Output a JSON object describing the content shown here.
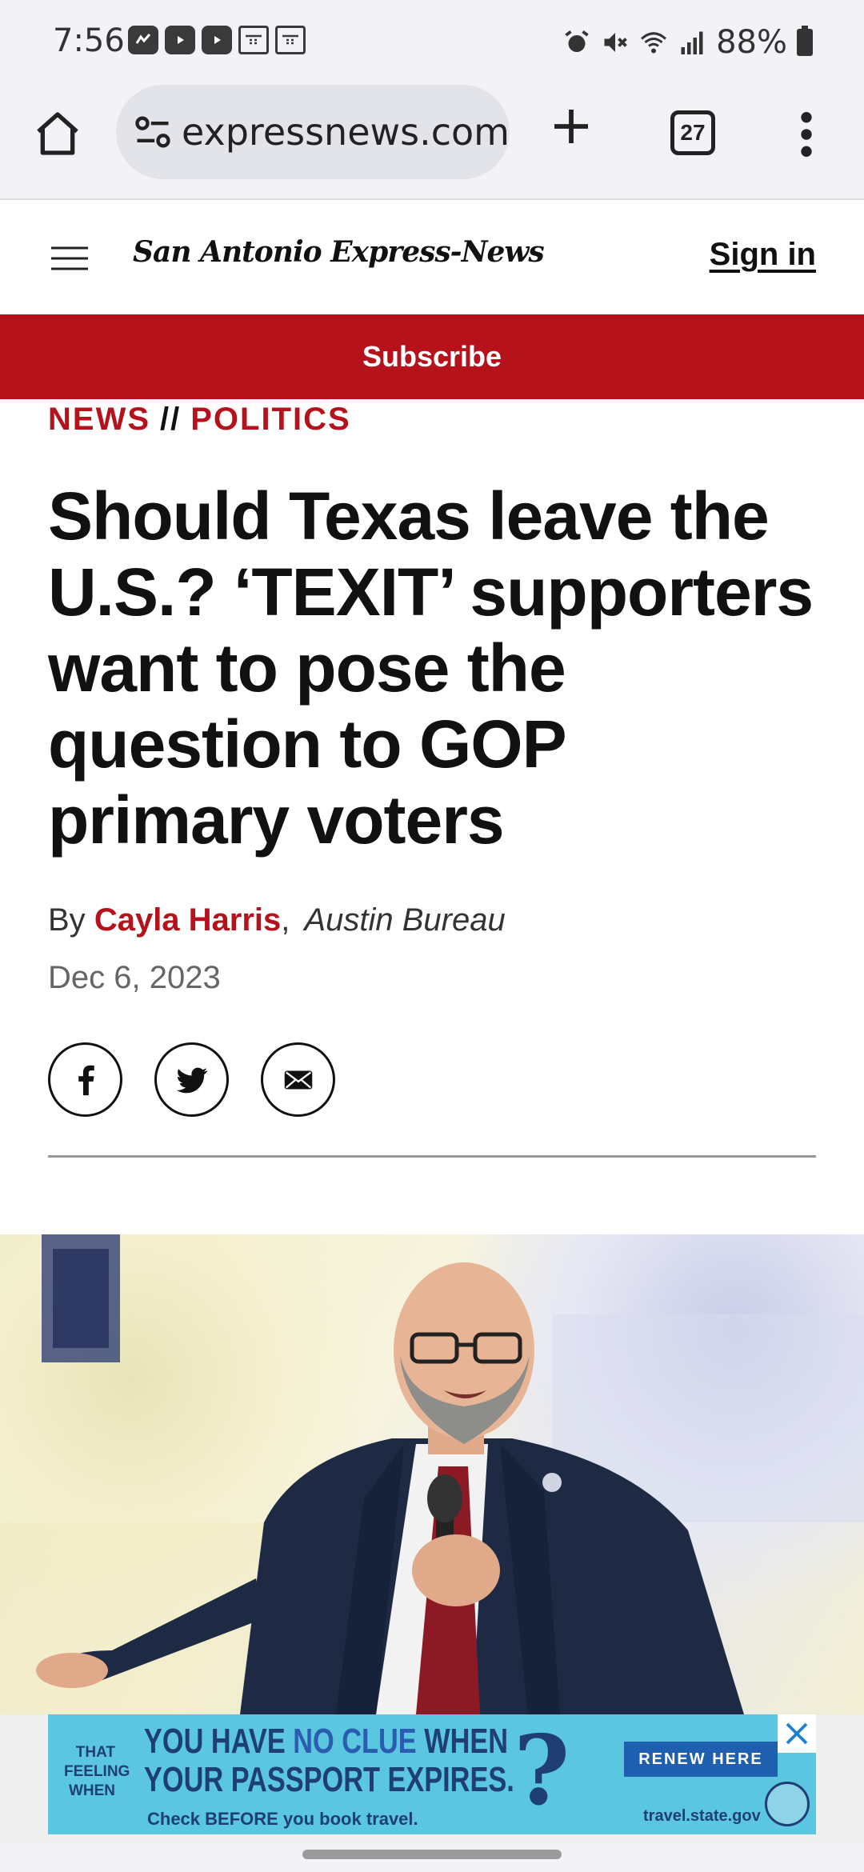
{
  "status_bar": {
    "time": "7:56",
    "battery": "88%",
    "app_icons": [
      "activity-icon",
      "youtube-icon",
      "youtube-icon",
      "calendar-icon",
      "calendar-icon"
    ],
    "system_icons": [
      "alarm-icon",
      "mute-icon",
      "wifi-icon",
      "signal-icon",
      "battery-icon"
    ]
  },
  "browser": {
    "url": "expressnews.com",
    "tab_count": "27"
  },
  "site": {
    "logo": "San Antonio Express-News",
    "sign_in": "Sign in",
    "subscribe": "Subscribe"
  },
  "article": {
    "breadcrumb": [
      "NEWS",
      "//",
      "POLITICS"
    ],
    "headline": "Should Texas leave the U.S.? ‘TEXIT’ supporters want to pose the question to GOP primary voters",
    "by": "By",
    "author": "Cayla Harris",
    "bureau": "Austin Bureau",
    "date": "Dec 6, 2023",
    "share": [
      "facebook-icon",
      "twitter-icon",
      "email-icon"
    ]
  },
  "ad": {
    "small_1": "THAT",
    "small_2": "FEELING",
    "small_3": "WHEN",
    "line1_a": "YOU HAVE ",
    "line1_b": "NO CLUE",
    "line1_c": " WHEN",
    "line2": "YOUR PASSPORT EXPIRES.",
    "check": "Check BEFORE you book travel.",
    "renew": "RENEW HERE",
    "site": "travel.state.gov",
    "question_mark": "?"
  },
  "colors": {
    "brand_red": "#b5121b",
    "ad_blue": "#5bc6e0",
    "ad_navy": "#1f3f73"
  }
}
